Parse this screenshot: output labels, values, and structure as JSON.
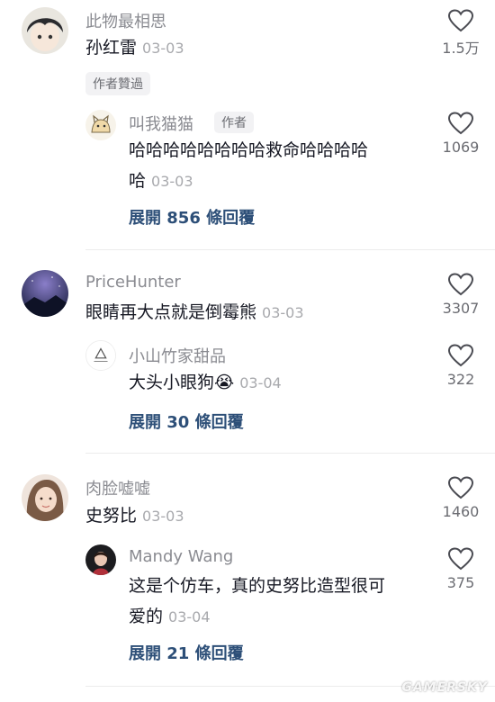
{
  "threads": [
    {
      "user": "此物最相思",
      "text": "孙红雷",
      "date": "03-03",
      "likes": "1.5万",
      "author_liked": "作者贊過",
      "avatar_icon": "anime-boy-avatar",
      "reply": {
        "user": "叫我猫猫",
        "author_badge": "作者",
        "text_line1": "哈哈哈哈哈哈哈哈救命哈哈哈哈",
        "text_line2": "哈",
        "date": "03-03",
        "likes": "1069",
        "avatar_icon": "cat-sketch-avatar"
      },
      "expand": "展開 856 條回覆"
    },
    {
      "user": "PriceHunter",
      "text": "眼睛再大点就是倒霉熊",
      "date": "03-03",
      "likes": "3307",
      "avatar_icon": "night-sky-avatar",
      "reply": {
        "user": "小山竹家甜品",
        "text": "大头小眼狗😭",
        "date": "03-04",
        "likes": "322",
        "avatar_icon": "dessert-logo-avatar"
      },
      "expand": "展開 30 條回覆"
    },
    {
      "user": "肉脸嘘嘘",
      "text": "史努比",
      "date": "03-03",
      "likes": "1460",
      "avatar_icon": "girl-photo-avatar",
      "reply": {
        "user": "Mandy Wang",
        "text_line1": "这是个仿车，真的史努比造型很可",
        "text_line2": "爱的",
        "date": "03-04",
        "likes": "375",
        "avatar_icon": "woman-photo-avatar"
      },
      "expand": "展開 21 條回覆"
    }
  ],
  "watermark": "GAMERSKY",
  "colors": {
    "link": "#2d4f78",
    "meta": "#8a8b91",
    "text": "#161823"
  }
}
